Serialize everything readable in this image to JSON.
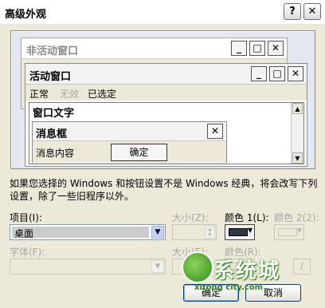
{
  "dialog": {
    "title": "高级外观",
    "help_btn": "?",
    "close_btn": "✕"
  },
  "preview": {
    "inactive_window": {
      "title": "非活动窗口",
      "btn_min": "_",
      "btn_max": "□",
      "btn_close": "✕"
    },
    "active_window": {
      "title": "活动窗口",
      "btn_min": "_",
      "btn_max": "□",
      "btn_close": "✕",
      "menu_normal": "正常",
      "menu_disabled": "无效",
      "menu_selected": "已选定",
      "window_text": "窗口文字"
    },
    "message_box": {
      "title": "消息框",
      "close": "✕",
      "text": "消息内容",
      "ok": "确定"
    }
  },
  "description": "如果您选择的 Windows 和按钮设置不是 Windows 经典，将会改写下列设置，除了一些旧程序以外。",
  "form": {
    "item_label": "项目(I):",
    "item_value": "桌面",
    "size_label": "大小(Z):",
    "color1_label": "颜色 1(L):",
    "color2_label": "颜色 2(2):",
    "font_label": "字体(F):",
    "font_size_label": "大小(E):",
    "font_color_label": "颜色(R):",
    "italic": "I",
    "color1_value": "#303742"
  },
  "buttons": {
    "ok": "确定",
    "cancel": "取消"
  },
  "watermark": {
    "brand": "系统城",
    "url": "xitong city.com"
  }
}
